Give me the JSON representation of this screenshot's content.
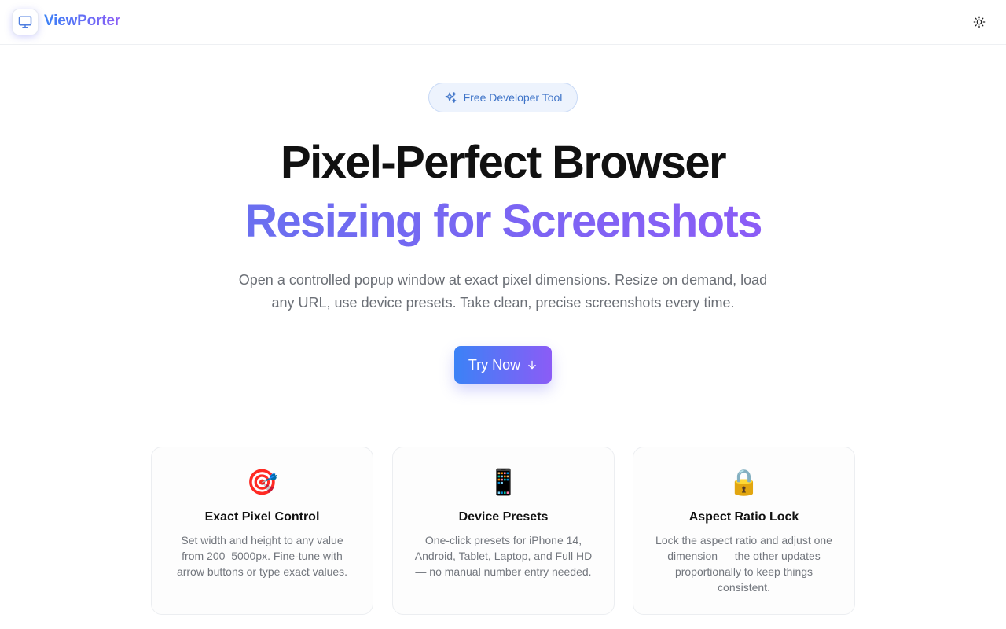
{
  "header": {
    "brand": "ViewPorter",
    "logo_icon": "monitor-icon",
    "theme_icon": "sun-icon"
  },
  "hero": {
    "badge": "Free Developer Tool",
    "badge_icon": "sparkles-icon",
    "title_line1": "Pixel-Perfect Browser",
    "title_line2": "Resizing for Screenshots",
    "subtitle_line1": "Open a controlled popup window at exact pixel dimensions. Resize on demand, load",
    "subtitle_line2": "any URL, use device presets. Take clean, precise screenshots every time.",
    "cta_label": "Try Now",
    "cta_icon": "arrow-down-icon"
  },
  "features": [
    {
      "emoji": "🎯",
      "title": "Exact Pixel Control",
      "description": "Set width and height to any value from 200–5000px. Fine-tune with arrow buttons or type exact values."
    },
    {
      "emoji": "📱",
      "title": "Device Presets",
      "description": "One-click presets for iPhone 14, Android, Tablet, Laptop, and Full HD — no manual number entry needed."
    },
    {
      "emoji": "🔒",
      "title": "Aspect Ratio Lock",
      "description": "Lock the aspect ratio and adjust one dimension — the other updates proportionally to keep things consistent."
    }
  ],
  "colors": {
    "accent_start": "#3b82f6",
    "accent_end": "#8b5cf6",
    "badge_text": "#3f74c8"
  }
}
